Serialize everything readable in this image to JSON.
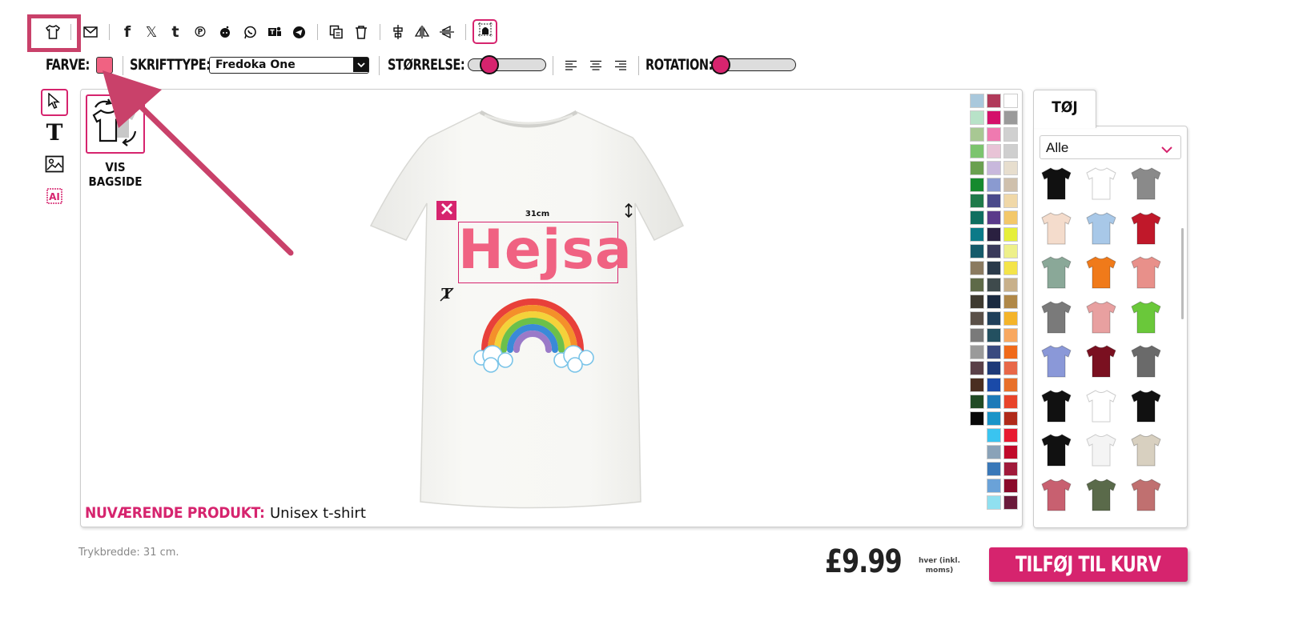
{
  "toolbar": {
    "icons": [
      "tshirt-icon",
      "mail-icon",
      "facebook-icon",
      "x-icon",
      "tumblr-icon",
      "pinterest-icon",
      "reddit-icon",
      "whatsapp-icon",
      "teams-icon",
      "telegram-icon",
      "duplicate-icon",
      "trash-icon",
      "center-icon",
      "flip-horizontal-icon",
      "flip-vertical-icon",
      "grid-icon"
    ]
  },
  "options": {
    "color_label": "FARVE:",
    "font_label": "SKRIFTTYPE:",
    "font_value": "Fredoka One",
    "size_label": "STØRRELSE:",
    "rotation_label": "ROTATION:",
    "size_level": 0.2,
    "rotation_level": 0.0,
    "selected_color": "#f06282"
  },
  "tools": [
    "cursor-icon",
    "text-icon",
    "image-icon",
    "ai-icon"
  ],
  "canvas": {
    "back_label_1": "VIS",
    "back_label_2": "BAGSIDE",
    "dimension": "31cm",
    "design_text": "Hejsa",
    "current_label": "NUVÆRENDE PRODUKT:",
    "current_value": "Unisex t-shirt"
  },
  "colors": [
    [
      "#a9c8dc",
      "#b03a5a",
      "#ffffff"
    ],
    [
      "#b8e2c8",
      "#d4106a",
      "#9a9a9a"
    ],
    [
      "#a8c893",
      "#ef7ab0",
      "#d0d0d0"
    ],
    [
      "#7cc46e",
      "#e8c3d6",
      "#cfcfcf"
    ],
    [
      "#6aa050",
      "#c8b8dc",
      "#e7dece"
    ],
    [
      "#168a2e",
      "#8a9ad0",
      "#cfc0ac"
    ],
    [
      "#1f7a4a",
      "#4a4a8a",
      "#f0d8a8"
    ],
    [
      "#0f6e60",
      "#5a3a8a",
      "#f3c86a"
    ],
    [
      "#0b7a88",
      "#2a2040",
      "#e6ef3a"
    ],
    [
      "#165a6a",
      "#3a3a5a",
      "#eef08a"
    ],
    [
      "#8a7a60",
      "#2a3a4a",
      "#f4e44a"
    ],
    [
      "#5e6a48",
      "#3e4a4c",
      "#c8b08a"
    ],
    [
      "#3e3a30",
      "#1a2a40",
      "#b08848"
    ],
    [
      "#5a5048",
      "#20405a",
      "#f4b42a"
    ],
    [
      "#7a7a7a",
      "#235060",
      "#f8a860"
    ],
    [
      "#9a9a9a",
      "#3a4a80",
      "#f06a1a"
    ],
    [
      "#5a4048",
      "#1e3a78",
      "#e86848"
    ],
    [
      "#4a2e20",
      "#1a4aa8",
      "#e8702a"
    ],
    [
      "#204a24",
      "#1c7ab8",
      "#e8442a"
    ],
    [
      "#080808",
      "#1a94c8",
      "#b02a1a"
    ],
    [
      null,
      "#3ac4f0",
      "#e81a30"
    ],
    [
      null,
      "#8aa2b8",
      "#c00a2a"
    ],
    [
      null,
      "#3a78b8",
      "#a01a3a"
    ],
    [
      null,
      "#6aa2d8",
      "#8a0a2a"
    ],
    [
      null,
      "#90e0f0",
      "#6a1a3a"
    ]
  ],
  "sidebar": {
    "tab": "TØJ",
    "filter": "Alle"
  },
  "products": [
    [
      "#111111",
      "#ffffff",
      "#8a8a8a"
    ],
    [
      "#f4dccc",
      "#a8c8e8",
      "#c0182a"
    ],
    [
      "#8aa898",
      "#f07a1a",
      "#e8908a"
    ],
    [
      "#7a7a7a",
      "#e8a0a0",
      "#6ac83a"
    ],
    [
      "#8a98d8",
      "#7a1020",
      "#6a6a6a"
    ],
    [
      "#111111",
      "#ffffff",
      "#111111"
    ],
    [
      "#111111",
      "#f4f4f4",
      "#d8d0c0"
    ],
    [
      "#c86070",
      "#5a6a4a",
      "#c07070"
    ]
  ],
  "footer": {
    "print_width": "Trykbredde: 31 cm.",
    "price": "£9.99",
    "price_note_1": "hver (inkl.",
    "price_note_2": "moms)",
    "add_to_cart": "TILFØJ TIL KURV"
  },
  "accent": "#d6246e",
  "highlight": "#c9416a"
}
